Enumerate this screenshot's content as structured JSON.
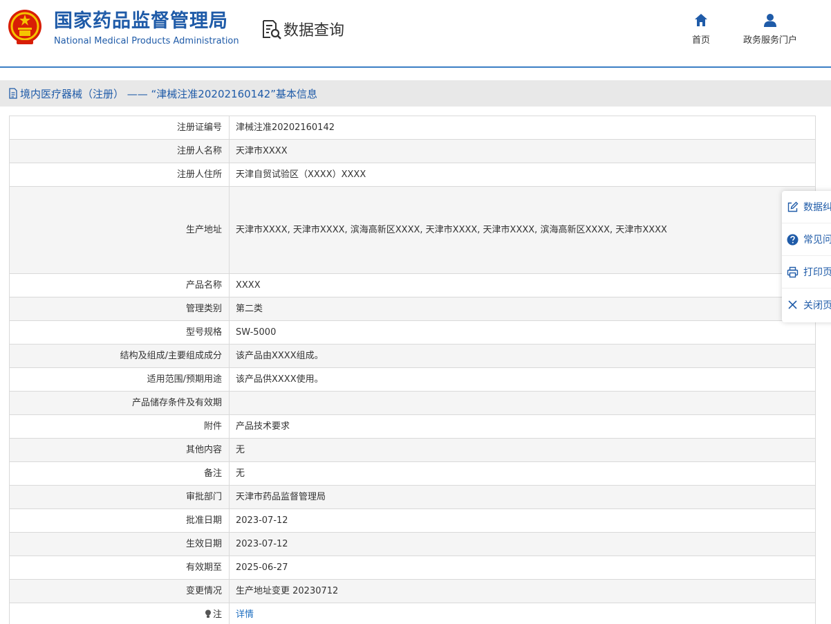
{
  "header": {
    "agency_name_cn": "国家药品监督管理局",
    "agency_name_en": "National Medical Products Administration",
    "query_title": "数据查询",
    "nav": [
      {
        "label": "首页",
        "icon": "home-icon"
      },
      {
        "label": "政务服务门户",
        "icon": "user-icon"
      }
    ]
  },
  "title_bar": {
    "text": "境内医疗器械（注册） —— “津械注准20202160142”基本信息"
  },
  "info_rows": [
    {
      "label": "注册证编号",
      "value": "津械注准20202160142"
    },
    {
      "label": "注册人名称",
      "value": "天津市XXXX"
    },
    {
      "label": "注册人住所",
      "value": "天津自贸试验区（XXXX）XXXX"
    },
    {
      "label": "生产地址",
      "value": "天津市XXXX, 天津市XXXX, 滨海高新区XXXX, 天津市XXXX, 天津市XXXX, 滨海高新区XXXX, 天津市XXXX"
    },
    {
      "label": "产品名称",
      "value": "XXXX"
    },
    {
      "label": "管理类别",
      "value": "第二类"
    },
    {
      "label": "型号规格",
      "value": "SW-5000"
    },
    {
      "label": "结构及组成/主要组成成分",
      "value": "该产品由XXXX组成。"
    },
    {
      "label": "适用范围/预期用途",
      "value": "该产品供XXXX使用。"
    },
    {
      "label": "产品储存条件及有效期",
      "value": ""
    },
    {
      "label": "附件",
      "value": "产品技术要求"
    },
    {
      "label": "其他内容",
      "value": "无"
    },
    {
      "label": "备注",
      "value": "无"
    },
    {
      "label": "审批部门",
      "value": "天津市药品监督管理局"
    },
    {
      "label": "批准日期",
      "value": "2023-07-12"
    },
    {
      "label": "生效日期",
      "value": "2023-07-12"
    },
    {
      "label": "有效期至",
      "value": "2025-06-27"
    },
    {
      "label": "变更情况",
      "value": "生产地址变更 20230712"
    },
    {
      "label": "注",
      "value": "详情"
    }
  ],
  "float_panel": [
    {
      "label": "数据纠错",
      "icon": "edit-icon"
    },
    {
      "label": "常见问题",
      "icon": "help-icon"
    },
    {
      "label": "打印页面",
      "icon": "print-icon"
    },
    {
      "label": "关闭页面",
      "icon": "close-icon"
    }
  ],
  "colors": {
    "brand_blue": "#1f5ba8",
    "link_blue": "#1f6fc0",
    "header_rule": "#3b7ec4",
    "title_bar_bg": "#e8e8e8",
    "row_alt_bg": "#f5f5f5"
  }
}
